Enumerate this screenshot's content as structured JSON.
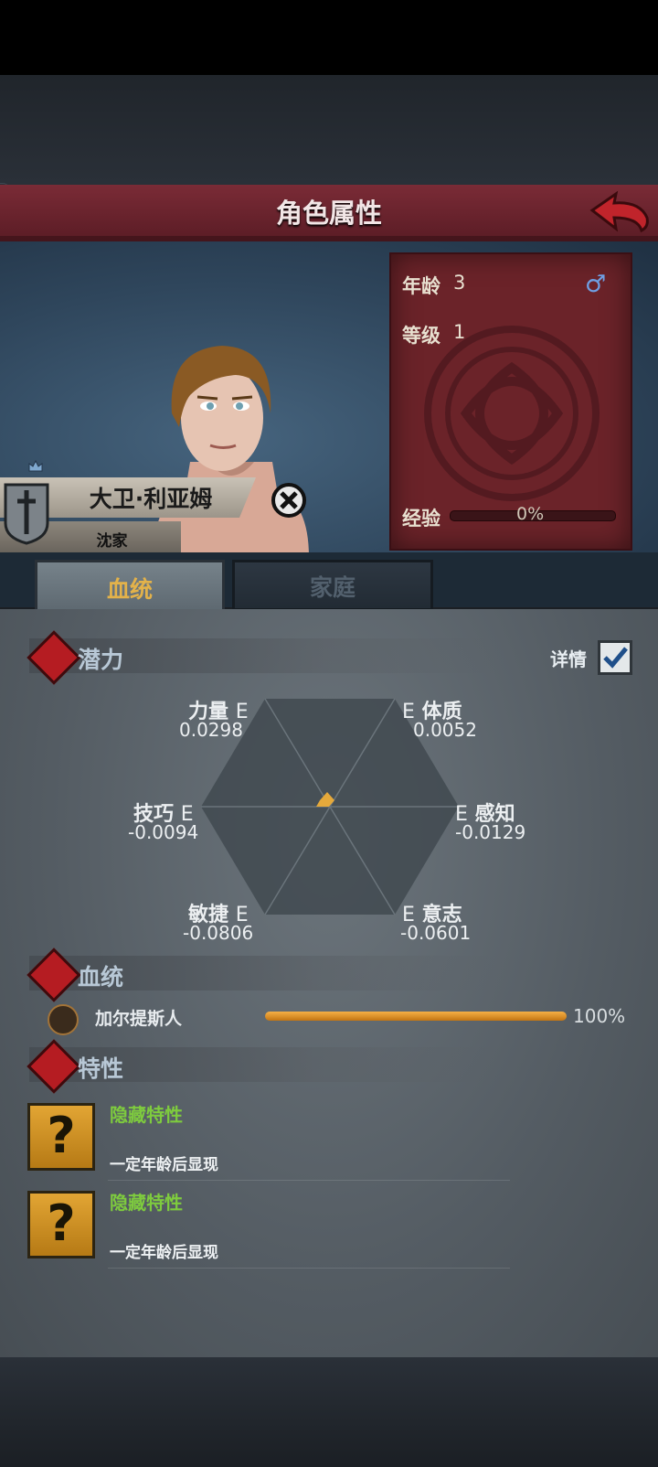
{
  "header": {
    "title": "角色属性"
  },
  "character": {
    "name": "大卫·利亚姆",
    "family": "沈家"
  },
  "stats_panel": {
    "age_label": "年龄",
    "age_value": "3",
    "gender_symbol": "♂",
    "level_label": "等级",
    "level_value": "1",
    "exp_label": "经验",
    "exp_text": "0%",
    "exp_progress": 0
  },
  "tabs": [
    {
      "label": "血统",
      "active": true
    },
    {
      "label": "家庭",
      "active": false
    }
  ],
  "potential": {
    "title": "潜力",
    "detail_label": "详情",
    "detail_checked": true,
    "stats": [
      {
        "name": "力量",
        "grade": "E",
        "value": "0.0298"
      },
      {
        "name": "体质",
        "grade": "E",
        "value": "0.0052"
      },
      {
        "name": "技巧",
        "grade": "E",
        "value": "-0.0094"
      },
      {
        "name": "感知",
        "grade": "E",
        "value": "-0.0129"
      },
      {
        "name": "敏捷",
        "grade": "E",
        "value": "-0.0806"
      },
      {
        "name": "意志",
        "grade": "E",
        "value": "-0.0601"
      }
    ]
  },
  "bloodline": {
    "title": "血统",
    "items": [
      {
        "name": "加尔提斯人",
        "percent_text": "100%",
        "percent": 100
      }
    ]
  },
  "traits": {
    "title": "特性",
    "items": [
      {
        "icon": "?",
        "name": "隐藏特性",
        "desc": "一定年龄后显现"
      },
      {
        "icon": "?",
        "name": "隐藏特性",
        "desc": "一定年龄后显现"
      }
    ]
  },
  "colors": {
    "accent_red": "#b51c22",
    "trait_green": "#7ecb3e",
    "tab_gold": "#e3b24a",
    "bar_orange": "#f6b046"
  }
}
